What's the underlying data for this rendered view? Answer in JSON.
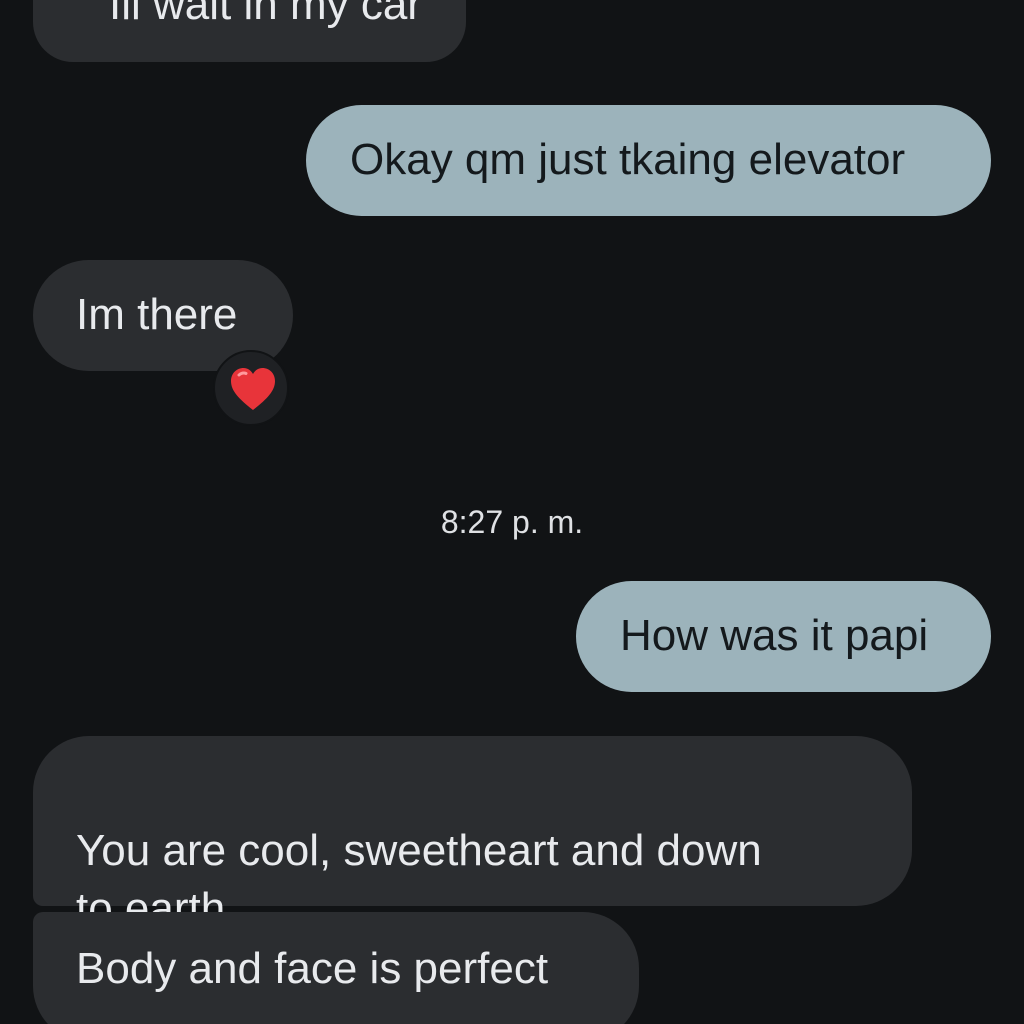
{
  "conversation": {
    "messages": [
      {
        "text": "Ill wait in my car",
        "direction": "incoming"
      },
      {
        "text": "Okay qm just tkaing elevator",
        "direction": "outgoing"
      },
      {
        "text": "Im there",
        "direction": "incoming",
        "reaction": "heart"
      },
      {
        "text": "How was it papi",
        "direction": "outgoing"
      },
      {
        "text": "You are cool, sweetheart and down\nto earth",
        "direction": "incoming"
      },
      {
        "text": "Body and face is perfect",
        "direction": "incoming"
      }
    ],
    "timestamp": "8:27 p. m."
  },
  "colors": {
    "background": "#111315",
    "incoming_bubble": "#2b2d30",
    "outgoing_bubble": "#9cb3bb",
    "reaction_heart": "#e8343a"
  }
}
